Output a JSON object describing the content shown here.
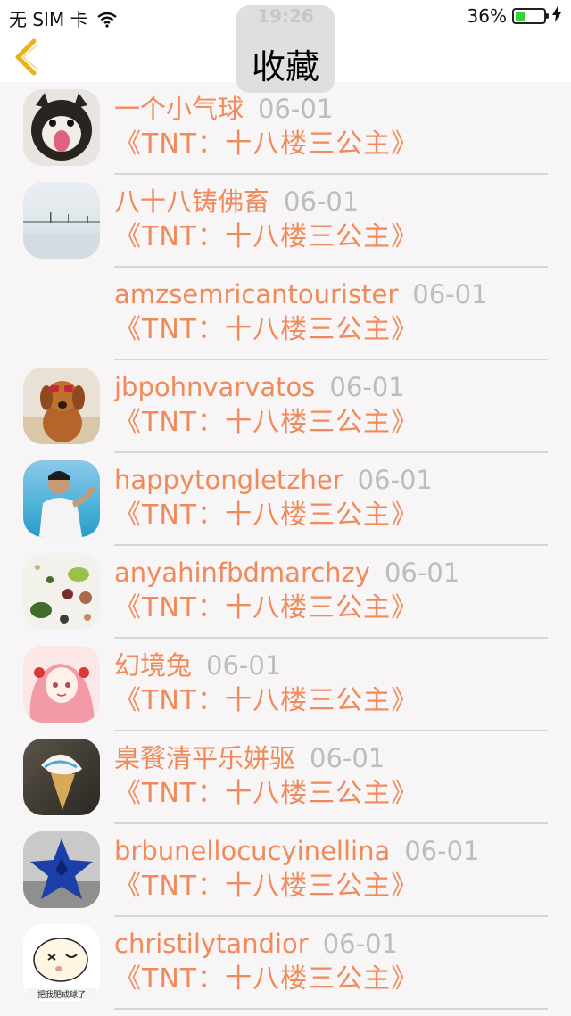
{
  "status": {
    "carrier": "无 SIM 卡",
    "time": "19:26",
    "battery": "36%",
    "battery_level": 0.36,
    "icons": [
      "wifi-icon",
      "battery-icon",
      "charging-icon"
    ]
  },
  "nav": {
    "title": "收藏",
    "back_icon": "chevron-left-icon"
  },
  "colors": {
    "accent": "#f08a5a",
    "back": "#e6b21f",
    "date": "#bdbdbd",
    "battery": "#3bd13b"
  },
  "items": [
    {
      "name": "一个小气球",
      "date": "06-01",
      "title": "《TNT：十八楼三公主》",
      "avatar": "husky-dog"
    },
    {
      "name": "八十八铸佛畜",
      "date": "06-01",
      "title": "《TNT：十八楼三公主》",
      "avatar": "snow-landscape"
    },
    {
      "name": "amzsemricantourister",
      "date": "06-01",
      "title": "《TNT：十八楼三公主》",
      "avatar": "none"
    },
    {
      "name": "jbpohnvarvatos",
      "date": "06-01",
      "title": "《TNT：十八楼三公主》",
      "avatar": "dog-sunglasses"
    },
    {
      "name": "happytongletzher",
      "date": "06-01",
      "title": "《TNT：十八楼三公主》",
      "avatar": "beach-man"
    },
    {
      "name": "anyahinfbdmarchzy",
      "date": "06-01",
      "title": "《TNT：十八楼三公主》",
      "avatar": "plants-flatlay"
    },
    {
      "name": "幻境兔",
      "date": "06-01",
      "title": "《TNT：十八楼三公主》",
      "avatar": "anime-girl"
    },
    {
      "name": "臬餮清平乐姘驱",
      "date": "06-01",
      "title": "《TNT：十八楼三公主》",
      "avatar": "ice-cream"
    },
    {
      "name": "brbunellocucyinellina",
      "date": "06-01",
      "title": "《TNT：十八楼三公主》",
      "avatar": "blue-star"
    },
    {
      "name": "christilytandior",
      "date": "06-01",
      "title": "《TNT：十八楼三公主》",
      "avatar": "cartoon-face",
      "avatar_caption": "把我肥成球了"
    }
  ]
}
